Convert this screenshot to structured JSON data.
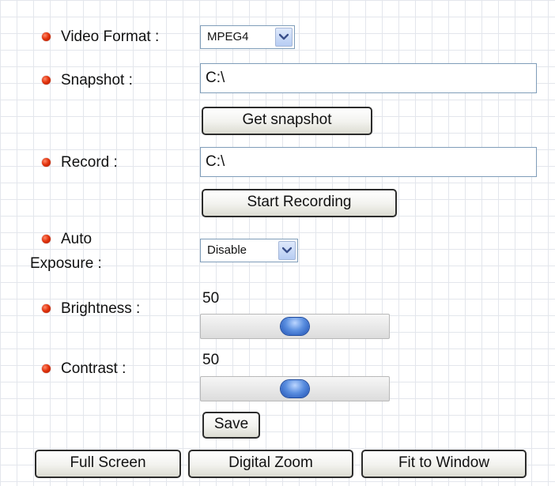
{
  "video_format": {
    "label": "Video Format :",
    "value": "MPEG4"
  },
  "snapshot": {
    "label": "Snapshot :",
    "path": "C:\\",
    "button_label": "Get snapshot"
  },
  "record": {
    "label": "Record :",
    "path": "C:\\",
    "button_label": "Start Recording"
  },
  "auto_exposure": {
    "label_line1": "Auto",
    "label_line2": "Exposure :",
    "value": "Disable"
  },
  "brightness": {
    "label": "Brightness :",
    "value": "50",
    "level_percent": 50
  },
  "contrast": {
    "label": "Contrast :",
    "value": "50",
    "level_percent": 50
  },
  "save_label": "Save",
  "bottom_buttons": {
    "full_screen": "Full Screen",
    "digital_zoom": "Digital Zoom",
    "fit_to_window": "Fit to Window"
  },
  "icons": {
    "bullet": "red-bullet-icon",
    "dropdown": "chevron-down-icon"
  },
  "colors": {
    "bullet": "#e3330d",
    "slider_thumb": "#3f74d0",
    "field_border": "#7f9db9",
    "grid_line": "#e3e6ec"
  }
}
